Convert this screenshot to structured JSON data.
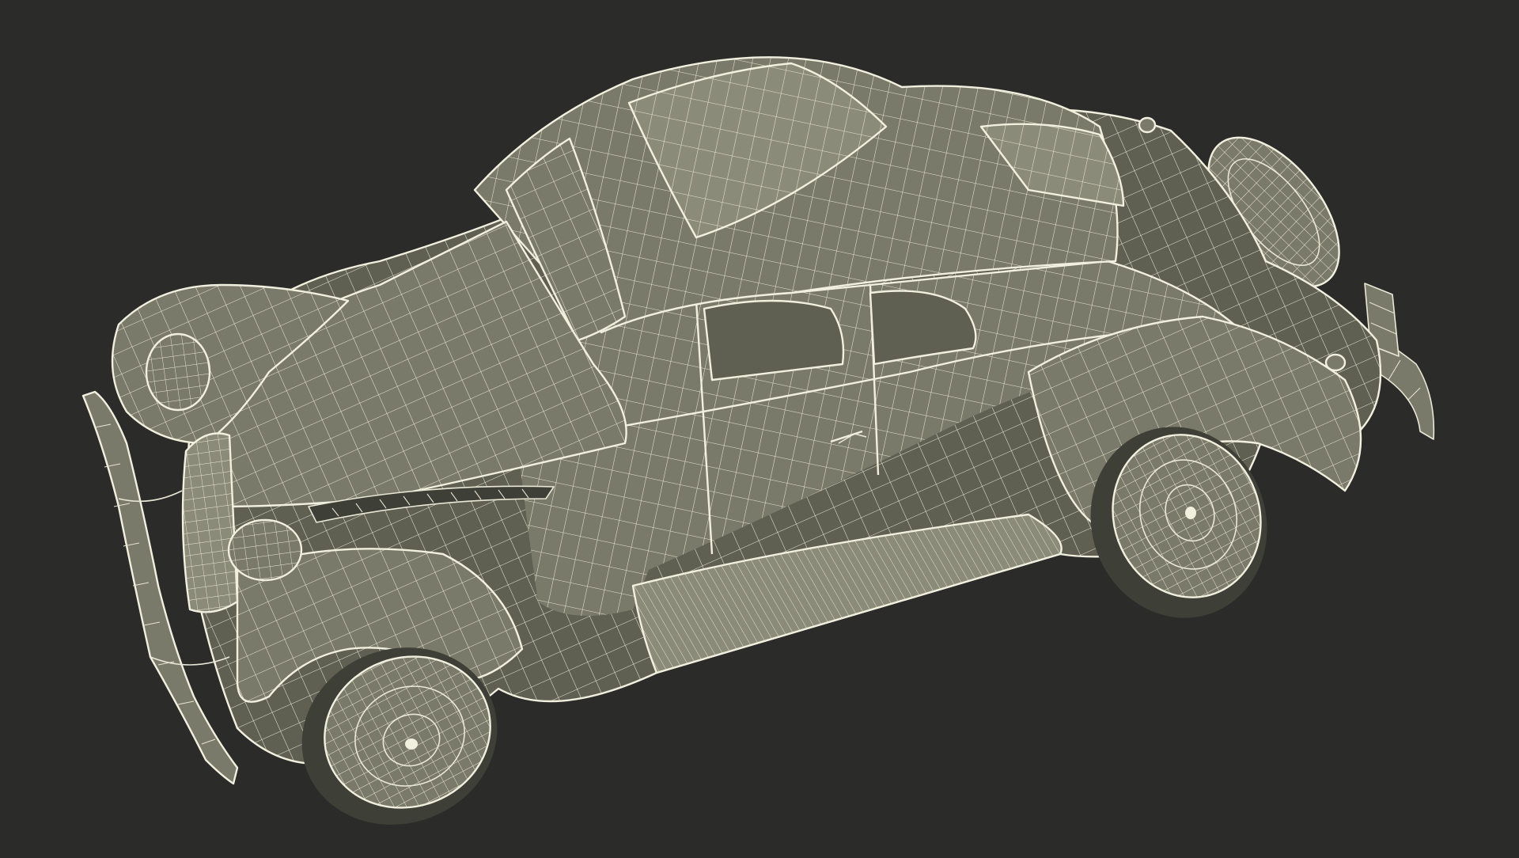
{
  "scene": {
    "background": "#2b2b29",
    "model_fill": "#7a7a6a",
    "wire_color": "#e9e8d6"
  }
}
